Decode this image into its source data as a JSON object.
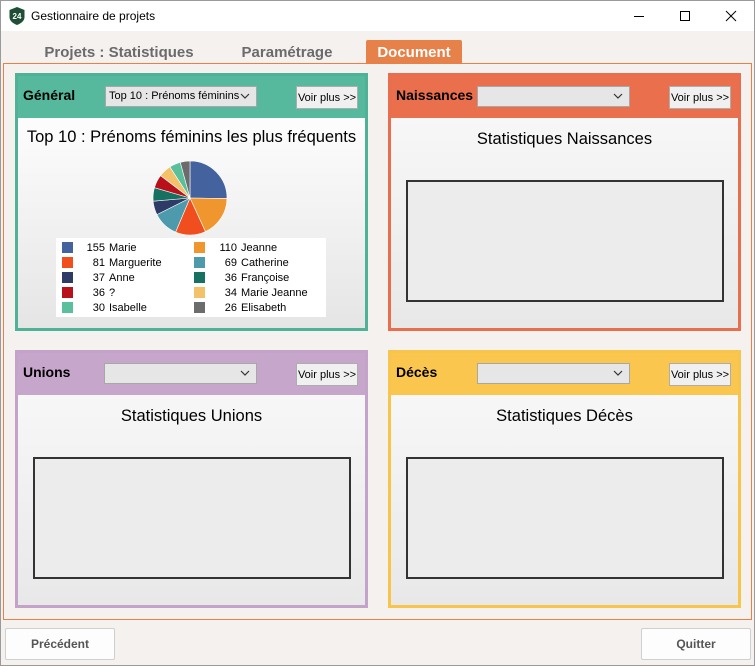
{
  "window": {
    "title": "Gestionnaire de projets",
    "icon_text": "24",
    "controls": [
      "minimize",
      "maximize",
      "close"
    ]
  },
  "tabs": [
    {
      "label": "Projets : Statistiques",
      "active": false
    },
    {
      "label": "Paramétrage",
      "active": false
    },
    {
      "label": "Document",
      "active": true
    }
  ],
  "colors": {
    "accent": "#e7814a",
    "general": "#56b89c",
    "naissances": "#ea6f4d",
    "unions": "#c6a6ca",
    "deces": "#fac64e"
  },
  "panels": {
    "general": {
      "title": "Général",
      "select_value": "Top 10 : Prénoms féminins",
      "more_label": "Voir plus >>",
      "chart_title": "Top 10 : Prénoms féminins les plus fréquents"
    },
    "naissances": {
      "title": "Naissances",
      "select_value": "",
      "more_label": "Voir plus >>",
      "stat_title": "Statistiques Naissances"
    },
    "unions": {
      "title": "Unions",
      "select_value": "",
      "more_label": "Voir plus >>",
      "stat_title": "Statistiques Unions"
    },
    "deces": {
      "title": "Décès",
      "select_value": "",
      "more_label": "Voir plus >>",
      "stat_title": "Statistiques Décès"
    }
  },
  "chart_data": {
    "type": "pie",
    "title": "Top 10 : Prénoms féminins les plus fréquents",
    "legend_position": "bottom",
    "series": [
      {
        "name": "Marie",
        "value": 155,
        "color": "#44639e"
      },
      {
        "name": "Jeanne",
        "value": 110,
        "color": "#f0962e"
      },
      {
        "name": "Marguerite",
        "value": 81,
        "color": "#f04e1e"
      },
      {
        "name": "Catherine",
        "value": 69,
        "color": "#4d9aad"
      },
      {
        "name": "Anne",
        "value": 37,
        "color": "#2d3b66"
      },
      {
        "name": "Françoise",
        "value": 36,
        "color": "#167160"
      },
      {
        "name": "?",
        "value": 36,
        "color": "#b8111b"
      },
      {
        "name": "Marie Jeanne",
        "value": 34,
        "color": "#f2c16a"
      },
      {
        "name": "Isabelle",
        "value": 30,
        "color": "#5abf9d"
      },
      {
        "name": "Elisabeth",
        "value": 26,
        "color": "#6c6c6c"
      }
    ]
  },
  "footer": {
    "prev_label": "Précédent",
    "quit_label": "Quitter"
  }
}
